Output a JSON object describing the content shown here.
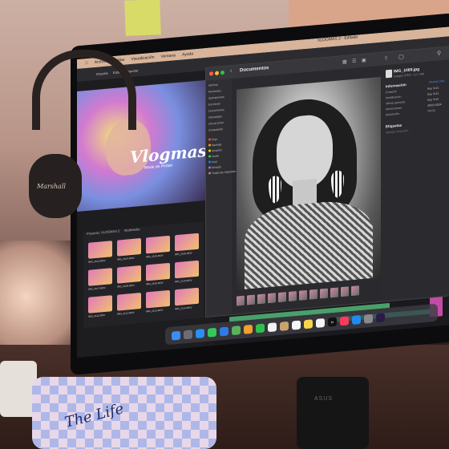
{
  "scene": {
    "sticky_note_color": "#d9db68",
    "wall_color": "#cdb0a4"
  },
  "menubar": {
    "items": [
      "Archivo",
      "Editar",
      "Visualización",
      "Ventana",
      "Ayuda"
    ],
    "document_title": "VLOGMAS 2 - Editado"
  },
  "editor": {
    "toolbar": [
      "Importar",
      "Editar",
      "Exportar"
    ],
    "preview_title": "Vlogmas",
    "preview_subtitle": "Made de Pettan",
    "bins_tabs": [
      "Proyecto: VLOGMAS 2",
      "Multimedia"
    ],
    "clips": [
      "IMG_2103.MOV",
      "IMG_2104.MOV",
      "IMG_2105.MOV",
      "IMG_2106.MOV",
      "IMG_2107.MOV",
      "IMG_2108.MOV",
      "IMG_2109.MOV",
      "IMG_2110.MOV",
      "IMG_2111.MOV",
      "IMG_2112.MOV",
      "IMG_2113.MOV",
      "IMG_2114.MOV"
    ]
  },
  "finder": {
    "title": "Documentos",
    "sidebar_favorites": [
      "AirDrop",
      "Recientes",
      "Aplicaciones",
      "Escritorio",
      "Documentos",
      "Descargas"
    ],
    "sidebar_locations": [
      "iCloud Drive",
      "Compartido"
    ],
    "tags": [
      {
        "label": "Rojo",
        "color": "#ff453a"
      },
      {
        "label": "Naranja",
        "color": "#ff9f0a"
      },
      {
        "label": "Amarillo",
        "color": "#ffd60a"
      },
      {
        "label": "Verde",
        "color": "#30d158"
      },
      {
        "label": "Azul",
        "color": "#0a84ff"
      },
      {
        "label": "Morado",
        "color": "#bf5af2"
      },
      {
        "label": "Todas las etiquetas",
        "color": "#8e8e93"
      }
    ],
    "thumbnail_count": 12
  },
  "info_panel": {
    "file_name": "IMG_1069.jpg",
    "file_sub": "Imagen JPEG - 12,7 MB",
    "section_info": "Información",
    "more_info": "Mostrar más",
    "rows": [
      {
        "label": "Creación",
        "value": "hoy, 9:41"
      },
      {
        "label": "Modificación",
        "value": "hoy, 9:41"
      },
      {
        "label": "Última apertura",
        "value": "hoy, 9:42"
      },
      {
        "label": "Dimensiones",
        "value": "4032×3024"
      },
      {
        "label": "Resolución",
        "value": "72×72"
      }
    ],
    "section_tags": "Etiquetas",
    "tags_placeholder": "Agregar etiquetas..."
  },
  "dock": {
    "apps": [
      {
        "name": "Finder",
        "color": "#3b8df0"
      },
      {
        "name": "Launchpad",
        "color": "#6d6d75"
      },
      {
        "name": "Safari",
        "color": "#2a8ff0"
      },
      {
        "name": "Mensajes",
        "color": "#34c759"
      },
      {
        "name": "Mail",
        "color": "#2f7ae5"
      },
      {
        "name": "Mapas",
        "color": "#58b35c"
      },
      {
        "name": "Fotos",
        "color": "#f0a030"
      },
      {
        "name": "FaceTime",
        "color": "#2fbf4f"
      },
      {
        "name": "Calendario",
        "color": "#f2f2f2"
      },
      {
        "name": "Contactos",
        "color": "#c9a56c"
      },
      {
        "name": "Recordatorios",
        "color": "#f5f5f5"
      },
      {
        "name": "Notas",
        "color": "#f7d54a"
      },
      {
        "name": "Freeform",
        "color": "#f5f5f5"
      },
      {
        "name": "TV",
        "color": "#111111"
      },
      {
        "name": "Música",
        "color": "#fa3c5c"
      },
      {
        "name": "App Store",
        "color": "#1e8cf0"
      },
      {
        "name": "Ajustes",
        "color": "#8a8a8e"
      },
      {
        "name": "Premiere",
        "color": "#2a1a4a"
      }
    ],
    "tv_label": "tv"
  },
  "headphones": {
    "brand": "Marshall"
  },
  "pillow": {
    "text": "The Life"
  },
  "monitor": {
    "brand": "ASUS"
  }
}
